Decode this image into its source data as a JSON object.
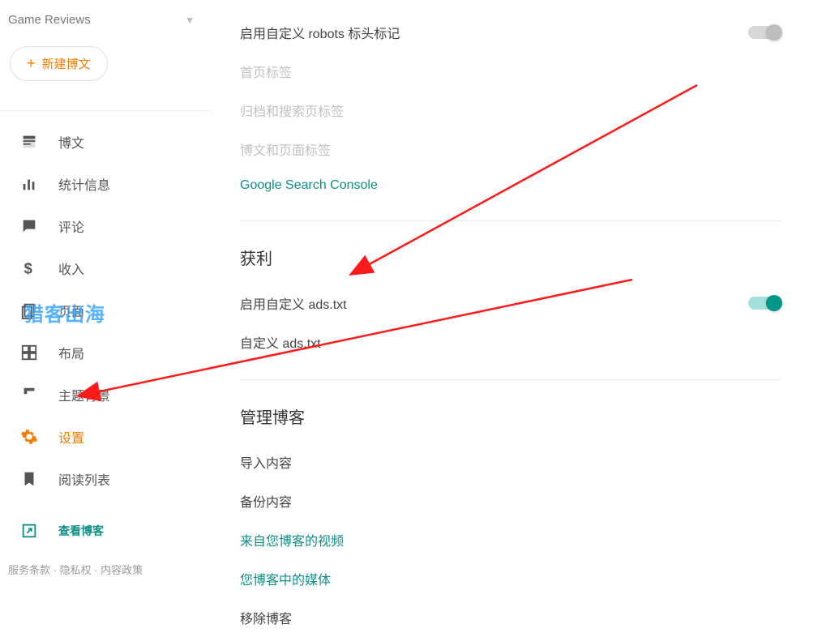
{
  "sidebar": {
    "blog_title": "Game Reviews",
    "new_post": "新建博文",
    "items": [
      {
        "label": "博文",
        "icon": "posts-icon"
      },
      {
        "label": "统计信息",
        "icon": "stats-icon"
      },
      {
        "label": "评论",
        "icon": "comments-icon"
      },
      {
        "label": "收入",
        "icon": "earnings-icon"
      },
      {
        "label": "页面",
        "icon": "pages-icon"
      },
      {
        "label": "布局",
        "icon": "layout-icon"
      },
      {
        "label": "主题背景",
        "icon": "theme-icon"
      },
      {
        "label": "设置",
        "icon": "settings-icon",
        "active": true
      },
      {
        "label": "阅读列表",
        "icon": "readinglist-icon"
      }
    ],
    "view_blog": "查看博客",
    "footer": {
      "tos": "服务条款",
      "privacy": "隐私权",
      "content": "内容政策"
    }
  },
  "watermark": "猎客出海",
  "settings": {
    "crawler": {
      "custom_robots_header": "启用自定义 robots 标头标记",
      "custom_robots_header_on": false,
      "home_tags": "首页标签",
      "archive_tags": "归档和搜索页标签",
      "post_tags": "博文和页面标签",
      "gsc_link": "Google Search Console"
    },
    "monetize": {
      "title": "获利",
      "enable_ads_txt": "启用自定义 ads.txt",
      "enable_ads_txt_on": true,
      "custom_ads_txt": "自定义 ads.txt"
    },
    "manage": {
      "title": "管理博客",
      "import": "导入内容",
      "backup": "备份内容",
      "videos_link": "来自您博客的视频",
      "media_link": "您博客中的媒体",
      "remove": "移除博客"
    }
  }
}
